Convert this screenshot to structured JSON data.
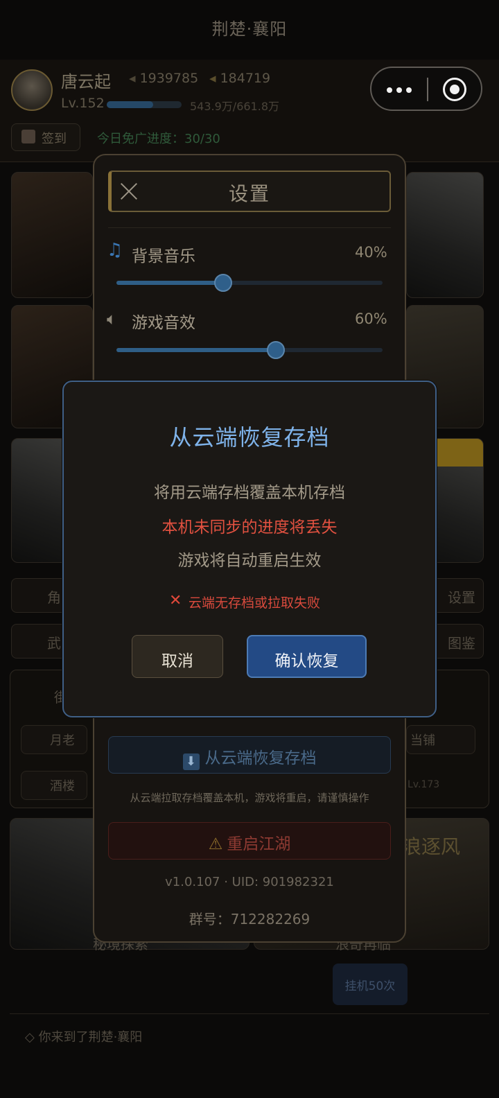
{
  "window": {
    "title": "荆楚·襄阳"
  },
  "player": {
    "name": "唐云起",
    "coins": "1939785",
    "ingots": "184719",
    "level": "Lv.152",
    "xp_text": "543.9万/661.8万",
    "xp_progress": 0.62
  },
  "header": {
    "checkin_label": "签到",
    "ad_progress": "今日免广进度：30/30"
  },
  "background": {
    "menu_left_1": "角",
    "menu_right_1": "设置",
    "menu_left_2": "武",
    "menu_right_2": "图鉴",
    "chip_yuelao": "月老",
    "chip_dangpu": "当铺",
    "chip_jiulou": "酒楼",
    "chip_level": "Lv.173",
    "chip_jie": "街",
    "card_explore": "秘境探索",
    "card_adventure": "浪奇再临",
    "card_adventure_title": "浪逐风",
    "hangup_label": "挂机50次",
    "log_text": "◇ 你来到了荆楚·襄阳"
  },
  "settings": {
    "title": "设置",
    "music_label": "背景音乐",
    "music_value": "40%",
    "music_level": 0.4,
    "sfx_label": "游戏音效",
    "sfx_value": "60%",
    "sfx_level": 0.6,
    "restore_label": "从云端恢复存档",
    "restore_hint": "从云端拉取存档覆盖本机，游戏将重启，请谨慎操作",
    "reset_label": "重启江湖",
    "version": "v1.0.107 · UID: 901982321",
    "group": "群号：712282269"
  },
  "modal": {
    "title": "从云端恢复存档",
    "line1": "将用云端存档覆盖本机存档",
    "line2": "本机未同步的进度将丢失",
    "line3": "游戏将自动重启生效",
    "error": "云端无存档或拉取失败",
    "cancel": "取消",
    "confirm": "确认恢复"
  },
  "colors": {
    "accent_blue": "#234a85",
    "warning_red": "#e25140",
    "title_blue": "#7fb3ea"
  },
  "icons": [
    "menu-dots-icon",
    "target-icon",
    "close-icon",
    "music-note-icon",
    "speaker-icon",
    "download-icon",
    "warning-icon",
    "error-x-icon",
    "calendar-icon",
    "coin-icon",
    "ingot-icon"
  ]
}
